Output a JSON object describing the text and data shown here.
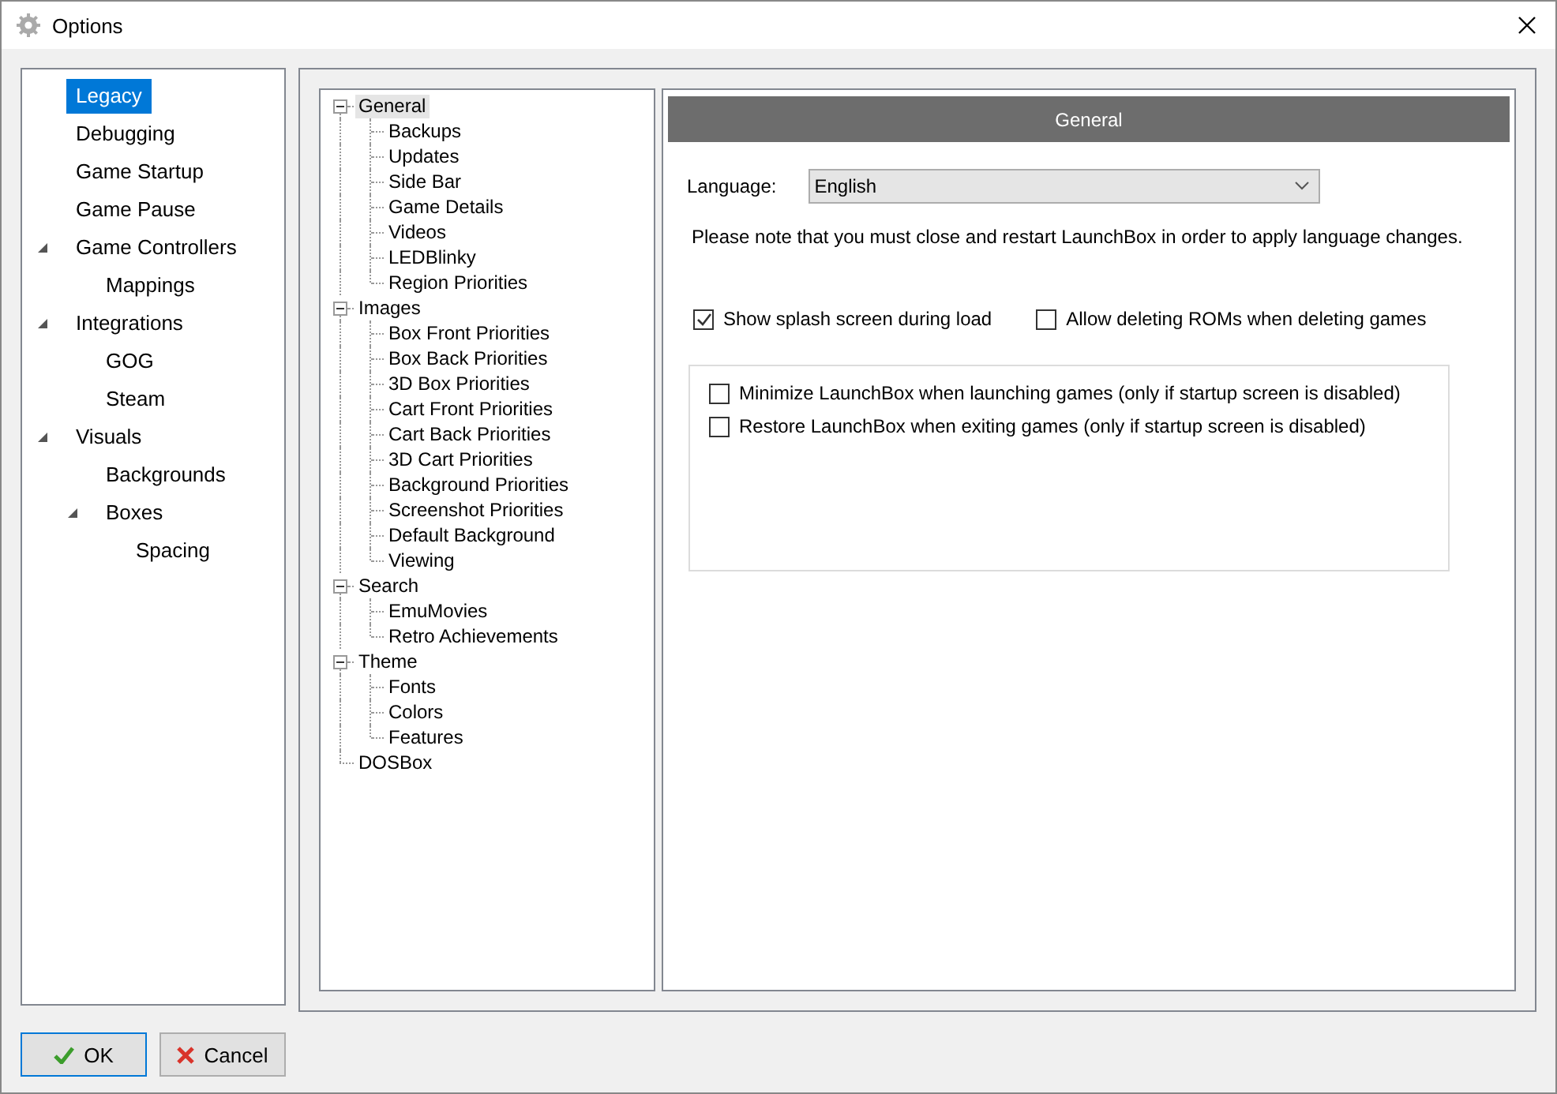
{
  "window": {
    "title": "Options"
  },
  "categories": [
    {
      "label": "Legacy",
      "selected": true
    },
    {
      "label": "Debugging",
      "selected": false
    },
    {
      "label": "Game Startup",
      "selected": false
    },
    {
      "label": "Game Pause",
      "selected": false
    },
    {
      "label": "Game Controllers",
      "selected": false,
      "expanded": true,
      "children": [
        {
          "label": "Mappings",
          "selected": false
        }
      ]
    },
    {
      "label": "Integrations",
      "selected": false,
      "expanded": true,
      "children": [
        {
          "label": "GOG",
          "selected": false
        },
        {
          "label": "Steam",
          "selected": false
        }
      ]
    },
    {
      "label": "Visuals",
      "selected": false,
      "expanded": true,
      "children": [
        {
          "label": "Backgrounds",
          "selected": false
        },
        {
          "label": "Boxes",
          "selected": false,
          "expanded": true,
          "children": [
            {
              "label": "Spacing",
              "selected": false
            }
          ]
        }
      ]
    }
  ],
  "sections": [
    {
      "label": "General",
      "selected": true,
      "expanded": true,
      "children": [
        {
          "label": "Backups"
        },
        {
          "label": "Updates"
        },
        {
          "label": "Side Bar"
        },
        {
          "label": "Game Details"
        },
        {
          "label": "Videos"
        },
        {
          "label": "LEDBlinky"
        },
        {
          "label": "Region Priorities"
        }
      ]
    },
    {
      "label": "Images",
      "selected": false,
      "expanded": true,
      "children": [
        {
          "label": "Box Front Priorities"
        },
        {
          "label": "Box Back Priorities"
        },
        {
          "label": "3D Box Priorities"
        },
        {
          "label": "Cart Front Priorities"
        },
        {
          "label": "Cart Back Priorities"
        },
        {
          "label": "3D Cart Priorities"
        },
        {
          "label": "Background Priorities"
        },
        {
          "label": "Screenshot Priorities"
        },
        {
          "label": "Default Background"
        },
        {
          "label": "Viewing"
        }
      ]
    },
    {
      "label": "Search",
      "selected": false,
      "expanded": true,
      "children": [
        {
          "label": "EmuMovies"
        },
        {
          "label": "Retro Achievements"
        }
      ]
    },
    {
      "label": "Theme",
      "selected": false,
      "expanded": true,
      "children": [
        {
          "label": "Fonts"
        },
        {
          "label": "Colors"
        },
        {
          "label": "Features"
        }
      ]
    },
    {
      "label": "DOSBox",
      "selected": false
    }
  ],
  "content": {
    "header": "General",
    "language": {
      "label": "Language:",
      "value": "English"
    },
    "note": "Please note that you must close and restart LaunchBox in order to apply language changes.",
    "options": [
      {
        "label": "Show splash screen during load",
        "checked": true
      },
      {
        "label": "Allow deleting ROMs when deleting games",
        "checked": false
      }
    ],
    "group_options": [
      {
        "label": "Minimize LaunchBox when launching games (only if startup screen is disabled)",
        "checked": false
      },
      {
        "label": "Restore LaunchBox when exiting games (only if startup screen is disabled)",
        "checked": false
      }
    ]
  },
  "buttons": [
    {
      "label": "OK",
      "kind": "ok"
    },
    {
      "label": "Cancel",
      "kind": "cancel"
    }
  ]
}
